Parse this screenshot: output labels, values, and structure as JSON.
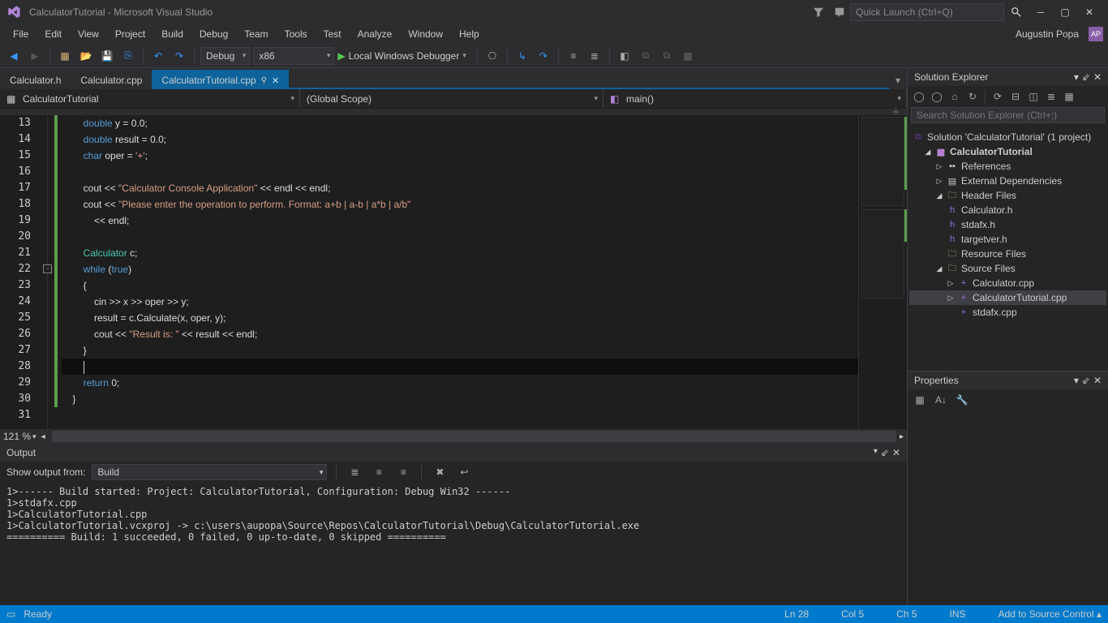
{
  "window": {
    "title": "CalculatorTutorial - Microsoft Visual Studio",
    "quick_launch_placeholder": "Quick Launch (Ctrl+Q)"
  },
  "menu": {
    "items": [
      "File",
      "Edit",
      "View",
      "Project",
      "Build",
      "Debug",
      "Team",
      "Tools",
      "Test",
      "Analyze",
      "Window",
      "Help"
    ],
    "user": "Augustin Popa",
    "user_initials": "AP"
  },
  "toolbar": {
    "config": "Debug",
    "platform": "x86",
    "debugger": "Local Windows Debugger"
  },
  "tabs": [
    {
      "label": "Calculator.h",
      "active": false
    },
    {
      "label": "Calculator.cpp",
      "active": false
    },
    {
      "label": "CalculatorTutorial.cpp",
      "active": true,
      "dirty": false,
      "pinned": true
    }
  ],
  "nav": {
    "scope1": "CalculatorTutorial",
    "scope2": "(Global Scope)",
    "scope3": "main()"
  },
  "code": {
    "first_line": 13,
    "lines": [
      {
        "n": 13,
        "seg": [
          {
            "c": "k",
            "t": "        double"
          },
          {
            "c": "p",
            "t": " y = "
          },
          {
            "c": "p",
            "t": "0.0"
          },
          {
            "c": "p",
            "t": ";"
          }
        ]
      },
      {
        "n": 14,
        "seg": [
          {
            "c": "k",
            "t": "        double"
          },
          {
            "c": "p",
            "t": " result = "
          },
          {
            "c": "p",
            "t": "0.0"
          },
          {
            "c": "p",
            "t": ";"
          }
        ]
      },
      {
        "n": 15,
        "seg": [
          {
            "c": "k",
            "t": "        char"
          },
          {
            "c": "p",
            "t": " oper = "
          },
          {
            "c": "s",
            "t": "'+'"
          },
          {
            "c": "p",
            "t": ";"
          }
        ]
      },
      {
        "n": 16,
        "seg": [
          {
            "c": "p",
            "t": " "
          }
        ]
      },
      {
        "n": 17,
        "seg": [
          {
            "c": "p",
            "t": "        cout << "
          },
          {
            "c": "s",
            "t": "\"Calculator Console Application\""
          },
          {
            "c": "p",
            "t": " << endl << endl;"
          }
        ]
      },
      {
        "n": 18,
        "seg": [
          {
            "c": "p",
            "t": "        cout << "
          },
          {
            "c": "s",
            "t": "\"Please enter the operation to perform. Format: a+b | a-b | a*b | a/b\""
          }
        ]
      },
      {
        "n": 19,
        "seg": [
          {
            "c": "p",
            "t": "            << endl;"
          }
        ]
      },
      {
        "n": 20,
        "seg": [
          {
            "c": "p",
            "t": " "
          }
        ]
      },
      {
        "n": 21,
        "seg": [
          {
            "c": "t",
            "t": "        Calculator"
          },
          {
            "c": "p",
            "t": " c;"
          }
        ]
      },
      {
        "n": 22,
        "seg": [
          {
            "c": "k",
            "t": "        while"
          },
          {
            "c": "p",
            "t": " ("
          },
          {
            "c": "k",
            "t": "true"
          },
          {
            "c": "p",
            "t": ")"
          }
        ]
      },
      {
        "n": 23,
        "seg": [
          {
            "c": "p",
            "t": "        {"
          }
        ]
      },
      {
        "n": 24,
        "seg": [
          {
            "c": "p",
            "t": "            cin >> x >> oper >> y;"
          }
        ]
      },
      {
        "n": 25,
        "seg": [
          {
            "c": "p",
            "t": "            result = c.Calculate(x, oper, y);"
          }
        ]
      },
      {
        "n": 26,
        "seg": [
          {
            "c": "p",
            "t": "            cout << "
          },
          {
            "c": "s",
            "t": "\"Result is: \""
          },
          {
            "c": "p",
            "t": " << result << endl;"
          }
        ]
      },
      {
        "n": 27,
        "seg": [
          {
            "c": "p",
            "t": "        }"
          }
        ]
      },
      {
        "n": 28,
        "seg": [
          {
            "c": "p",
            "t": "        "
          }
        ],
        "cursor": true
      },
      {
        "n": 29,
        "seg": [
          {
            "c": "k",
            "t": "        return"
          },
          {
            "c": "p",
            "t": " 0;"
          }
        ]
      },
      {
        "n": 30,
        "seg": [
          {
            "c": "p",
            "t": "    }"
          }
        ]
      },
      {
        "n": 31,
        "seg": [
          {
            "c": "p",
            "t": " "
          }
        ]
      }
    ]
  },
  "zoom": "121 %",
  "output": {
    "title": "Output",
    "from_label": "Show output from:",
    "from_value": "Build",
    "text": "1>------ Build started: Project: CalculatorTutorial, Configuration: Debug Win32 ------\n1>stdafx.cpp\n1>CalculatorTutorial.cpp\n1>CalculatorTutorial.vcxproj -> c:\\users\\aupopa\\Source\\Repos\\CalculatorTutorial\\Debug\\CalculatorTutorial.exe\n========== Build: 1 succeeded, 0 failed, 0 up-to-date, 0 skipped =========="
  },
  "solution": {
    "title": "Solution Explorer",
    "search_placeholder": "Search Solution Explorer (Ctrl+;)",
    "root": "Solution 'CalculatorTutorial' (1 project)",
    "project": "CalculatorTutorial",
    "refs": "References",
    "ext": "External Dependencies",
    "hdr": "Header Files",
    "hdr_items": [
      "Calculator.h",
      "stdafx.h",
      "targetver.h"
    ],
    "res": "Resource Files",
    "src": "Source Files",
    "src_items": [
      "Calculator.cpp",
      "CalculatorTutorial.cpp",
      "stdafx.cpp"
    ]
  },
  "properties": {
    "title": "Properties"
  },
  "status": {
    "ready": "Ready",
    "ln": "Ln 28",
    "col": "Col 5",
    "ch": "Ch 5",
    "ins": "INS",
    "scc": "Add to Source Control ▴"
  }
}
